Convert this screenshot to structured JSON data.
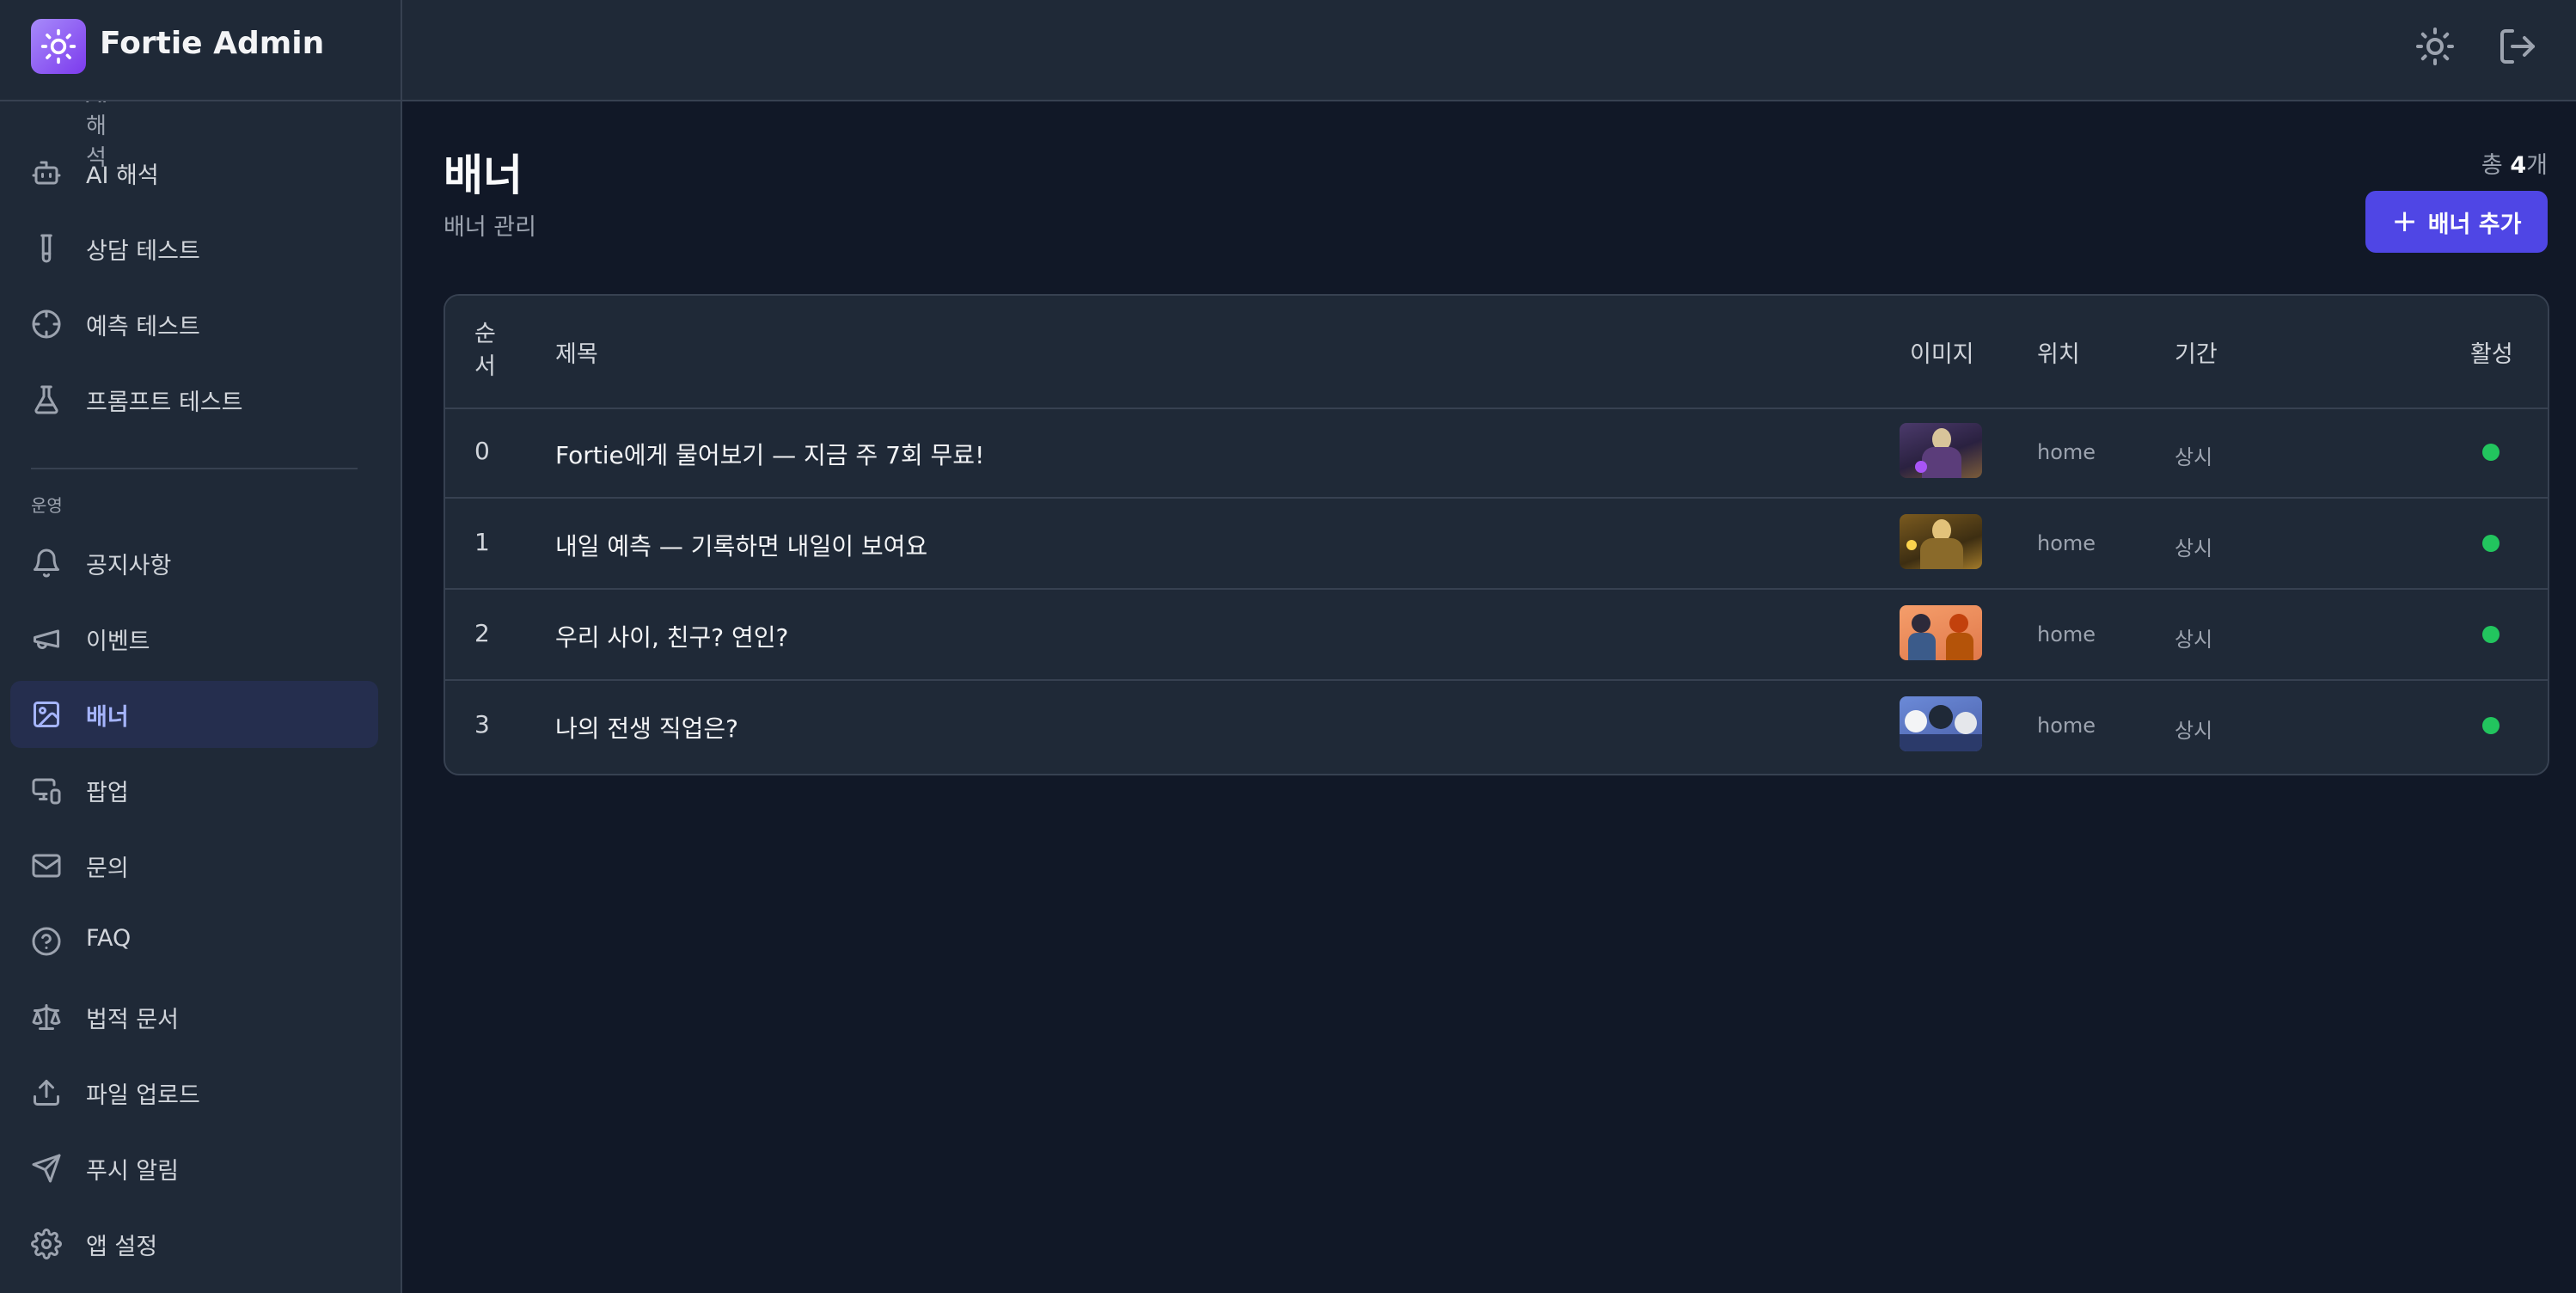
{
  "app": {
    "title": "Fortie Admin"
  },
  "sidebar": {
    "cut_item_label": "AI 해석",
    "items": [
      {
        "label": "AI 해석",
        "icon": "bot-icon"
      },
      {
        "label": "상담 테스트",
        "icon": "test-tube-icon"
      },
      {
        "label": "예측 테스트",
        "icon": "crosshair-icon"
      },
      {
        "label": "프롬프트 테스트",
        "icon": "flask-icon"
      }
    ],
    "section_label": "운영",
    "ops_items": [
      {
        "label": "공지사항",
        "icon": "bell-icon"
      },
      {
        "label": "이벤트",
        "icon": "megaphone-icon"
      },
      {
        "label": "배너",
        "icon": "image-icon",
        "active": true
      },
      {
        "label": "팝업",
        "icon": "monitor-smartphone-icon"
      },
      {
        "label": "문의",
        "icon": "mail-icon"
      },
      {
        "label": "FAQ",
        "icon": "help-circle-icon"
      },
      {
        "label": "법적 문서",
        "icon": "scale-icon"
      },
      {
        "label": "파일 업로드",
        "icon": "upload-icon"
      },
      {
        "label": "푸시 알림",
        "icon": "send-icon"
      },
      {
        "label": "앱 설정",
        "icon": "settings-icon"
      }
    ]
  },
  "topbar": {
    "theme_icon": "sun-icon",
    "logout_icon": "log-out-icon"
  },
  "page": {
    "title": "배너",
    "subtitle": "배너 관리",
    "total_prefix": "총 ",
    "total_count": "4",
    "total_suffix": "개",
    "add_button_label": "배너 추가"
  },
  "table": {
    "headers": {
      "order_line1": "순",
      "order_line2": "서",
      "title": "제목",
      "image": "이미지",
      "position": "위치",
      "period": "기간",
      "active": "활성"
    },
    "rows": [
      {
        "order": "0",
        "title": "Fortie에게 물어보기 — 지금 주 7회 무료!",
        "position": "home",
        "period": "상시",
        "active": true
      },
      {
        "order": "1",
        "title": "내일 예측 — 기록하면 내일이 보여요",
        "position": "home",
        "period": "상시",
        "active": true
      },
      {
        "order": "2",
        "title": "우리 사이, 친구? 연인?",
        "position": "home",
        "period": "상시",
        "active": true
      },
      {
        "order": "3",
        "title": "나의 전생 직업은?",
        "position": "home",
        "period": "상시",
        "active": true
      }
    ]
  },
  "colors": {
    "background": "#111827",
    "panel": "#1f2937",
    "accent": "#4f46e5",
    "active_nav": "#252e4e",
    "status_active": "#22c55e"
  }
}
